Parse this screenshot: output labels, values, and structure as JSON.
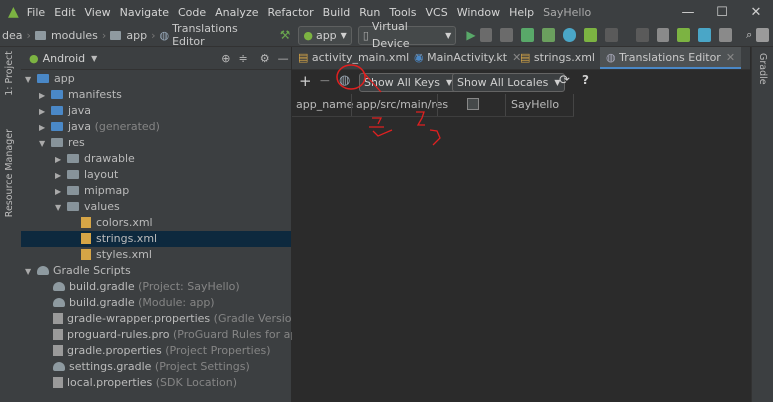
{
  "menu": [
    "File",
    "Edit",
    "View",
    "Navigate",
    "Code",
    "Analyze",
    "Refactor",
    "Build",
    "Run",
    "Tools",
    "VCS",
    "Window",
    "Help"
  ],
  "project_title": "SayHello",
  "window_controls": {
    "minimize": "—",
    "maximize": "☐",
    "close": "✕"
  },
  "breadcrumb": [
    "dea",
    "modules",
    "app",
    "Translations Editor"
  ],
  "run_config": "app",
  "device": "Virtual Device",
  "left_stripe": {
    "project": "1: Project",
    "resource_manager": "Resource Manager"
  },
  "right_stripe": {
    "gradle": "Gradle"
  },
  "project_panel": {
    "view_selector": "Android",
    "tree": [
      {
        "label": "app",
        "note": ""
      },
      {
        "label": "manifests",
        "note": ""
      },
      {
        "label": "java",
        "note": ""
      },
      {
        "label": "java",
        "note": "(generated)"
      },
      {
        "label": "res",
        "note": ""
      },
      {
        "label": "drawable",
        "note": ""
      },
      {
        "label": "layout",
        "note": ""
      },
      {
        "label": "mipmap",
        "note": ""
      },
      {
        "label": "values",
        "note": ""
      },
      {
        "label": "colors.xml",
        "note": ""
      },
      {
        "label": "strings.xml",
        "note": ""
      },
      {
        "label": "styles.xml",
        "note": ""
      },
      {
        "label": "Gradle Scripts",
        "note": ""
      },
      {
        "label": "build.gradle",
        "note": "(Project: SayHello)"
      },
      {
        "label": "build.gradle",
        "note": "(Module: app)"
      },
      {
        "label": "gradle-wrapper.properties",
        "note": "(Gradle Version)"
      },
      {
        "label": "proguard-rules.pro",
        "note": "(ProGuard Rules for app)"
      },
      {
        "label": "gradle.properties",
        "note": "(Project Properties)"
      },
      {
        "label": "settings.gradle",
        "note": "(Project Settings)"
      },
      {
        "label": "local.properties",
        "note": "(SDK Location)"
      }
    ]
  },
  "tabs": [
    {
      "label": "activity_main.xml"
    },
    {
      "label": "MainActivity.kt"
    },
    {
      "label": "strings.xml"
    },
    {
      "label": "Translations Editor"
    }
  ],
  "translations_toolbar": {
    "add": "+",
    "remove": "−",
    "keys_filter": "Show All Keys",
    "locales_filter": "Show All Locales",
    "help": "?"
  },
  "table_headers": [
    "app_name",
    "app/src/main/res",
    "SayHello"
  ],
  "colors": {
    "accent": "#4a88c7",
    "annotation": "#e02020",
    "selection": "#0d293e"
  }
}
